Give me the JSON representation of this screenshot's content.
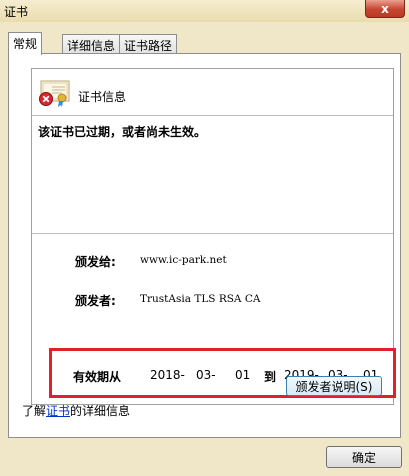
{
  "window": {
    "title": "证书",
    "close": "x"
  },
  "tabs": [
    {
      "label": "常规"
    },
    {
      "label": "详细信息"
    },
    {
      "label": "证书路径"
    }
  ],
  "info": {
    "title": "证书信息",
    "warning": "该证书已过期，或者尚未生效。"
  },
  "issued_to": {
    "label": "颁发给:",
    "value": "www.ic-park.net"
  },
  "issued_by": {
    "label": "颁发者:",
    "value": "TrustAsia TLS RSA CA"
  },
  "validity": {
    "label": "有效期从",
    "from": [
      "2018-",
      "03-",
      "01"
    ],
    "to_label": "到",
    "to": [
      "2019-",
      "03-",
      "01"
    ]
  },
  "issuer_statement_button": "颁发者说明(S)",
  "learn_more": {
    "prefix": "了解",
    "link": "证书",
    "suffix": "的详细信息"
  },
  "ok_button": "确定",
  "colors": {
    "highlight_border": "#e0202a",
    "link": "#0033cc"
  }
}
